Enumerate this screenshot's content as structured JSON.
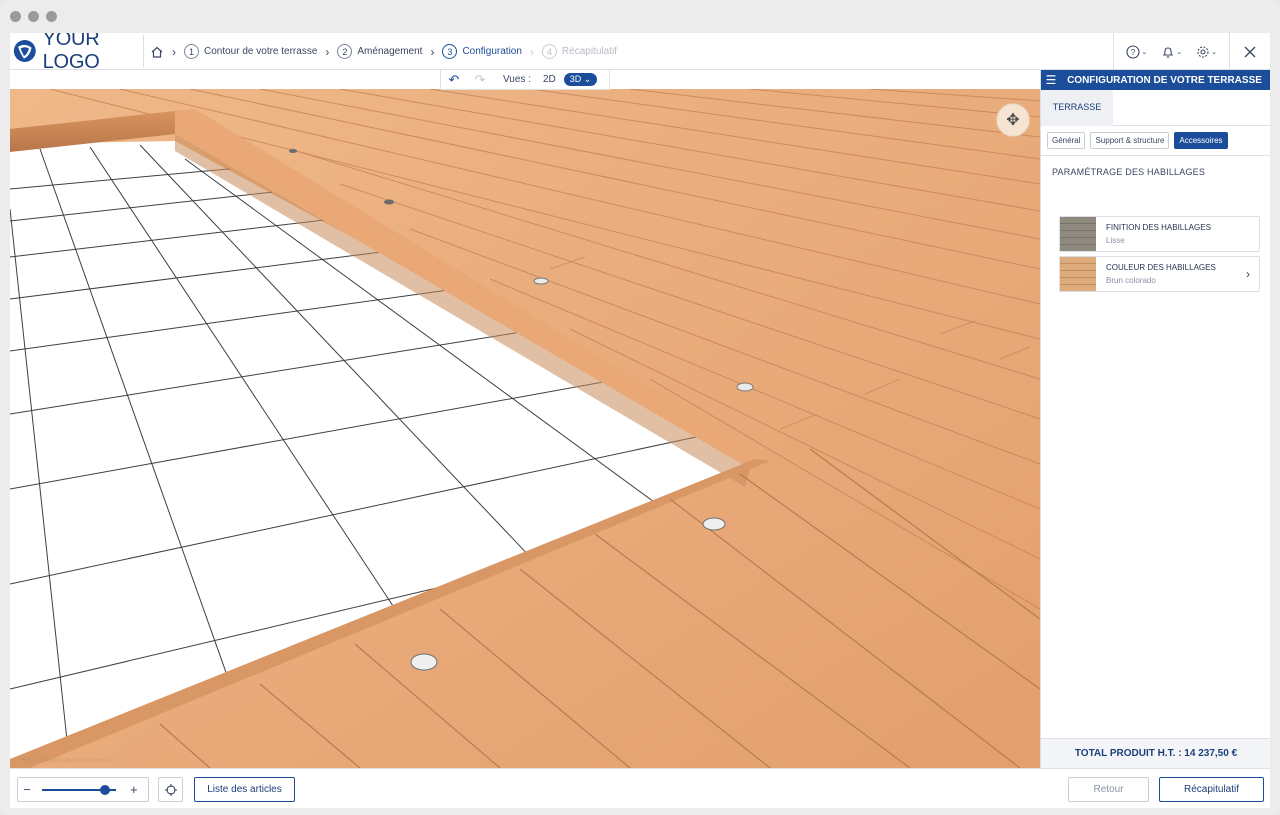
{
  "logo": {
    "text": "YOUR LOGO"
  },
  "breadcrumb": {
    "home_icon": "home-icon",
    "steps": [
      {
        "num": "1",
        "label": "Contour de votre terrasse",
        "state": "done"
      },
      {
        "num": "2",
        "label": "Aménagement",
        "state": "done"
      },
      {
        "num": "3",
        "label": "Configuration",
        "state": "active"
      },
      {
        "num": "4",
        "label": "Récapitulatif",
        "state": "disabled"
      }
    ]
  },
  "header_actions": {
    "help_icon": "question-circle-icon",
    "notifications_icon": "bell-icon",
    "settings_icon": "gear-icon",
    "close_icon": "close-icon"
  },
  "viewer": {
    "undo_icon": "undo-icon",
    "redo_icon": "redo-icon",
    "views_label": "Vues :",
    "view_2d": "2D",
    "view_3d": "3D",
    "selected_view": "3D",
    "orbit_icon": "orbit-camera-icon",
    "watermark": "Produit configuré par ©Sandbox 3D"
  },
  "panel": {
    "title": "CONFIGURATION DE VOTRE TERRASSE",
    "tab": "TERRASSE",
    "subtabs": [
      "Général",
      "Support & structure",
      "Accessoires"
    ],
    "active_subtab": "Accessoires",
    "section_title": "PARAMÉTRAGE DES HABILLAGES",
    "options": [
      {
        "title": "FINITION DES HABILLAGES",
        "value": "Lisse",
        "swatch_color": "#8f8a7e"
      },
      {
        "title": "COULEUR DES HABILLAGES",
        "value": "Brun colorado",
        "swatch_color": "#d9a779"
      }
    ],
    "total": "TOTAL PRODUIT H.T. : 14 237,50 €"
  },
  "footer": {
    "zoom_level": 0.85,
    "list_button": "Liste des articles",
    "back_button": "Retour",
    "recap_button": "Récapitulatif"
  },
  "colors": {
    "brand": "#1b4d9a",
    "wood": "#e8a878",
    "tile": "#ffffff"
  }
}
